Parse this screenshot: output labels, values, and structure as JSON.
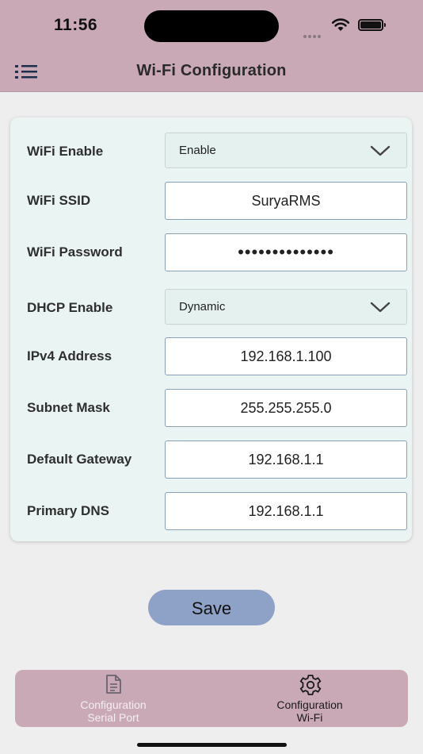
{
  "status_bar": {
    "time": "11:56"
  },
  "header": {
    "title": "Wi-Fi Configuration",
    "menu_icon": "list-menu-icon"
  },
  "form": {
    "wifi_enable": {
      "label": "WiFi Enable",
      "value": "Enable"
    },
    "wifi_ssid": {
      "label": "WiFi SSID",
      "value": "SuryaRMS"
    },
    "wifi_password": {
      "label": "WiFi Password",
      "value": "••••••••••••••"
    },
    "dhcp_enable": {
      "label": "DHCP Enable",
      "value": "Dynamic"
    },
    "ipv4_address": {
      "label": "IPv4 Address",
      "value": "192.168.1.100"
    },
    "subnet_mask": {
      "label": "Subnet Mask",
      "value": "255.255.255.0"
    },
    "default_gateway": {
      "label": "Default Gateway",
      "value": "192.168.1.1"
    },
    "primary_dns": {
      "label": "Primary DNS",
      "value": "192.168.1.1"
    }
  },
  "save_button": {
    "label": "Save"
  },
  "tabs": [
    {
      "label_line1": "Configuration",
      "label_line2": "Serial Port",
      "icon": "document-icon",
      "active": false
    },
    {
      "label_line1": "Configuration",
      "label_line2": "Wi-Fi",
      "icon": "gear-icon",
      "active": true
    }
  ],
  "colors": {
    "header_bg": "#c9a9b6",
    "card_bg": "#e9f4f3",
    "save_button_bg": "#8ea2c8",
    "page_bg": "#efeeee"
  }
}
